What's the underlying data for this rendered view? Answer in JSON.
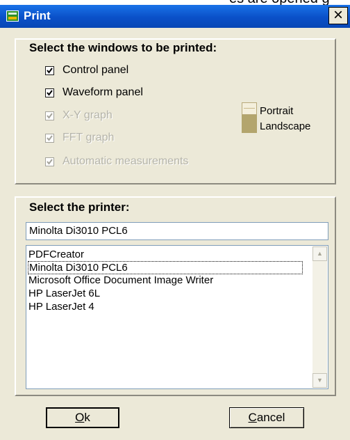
{
  "top_strip_text": "es are opened g",
  "window": {
    "title": "Print",
    "close_glyph": "×",
    "icon": "oscilloscope-app-icon"
  },
  "windows_section": {
    "heading": "Select the windows to be printed:",
    "items": [
      {
        "label": "Control panel",
        "checked": true,
        "enabled": true
      },
      {
        "label": "Waveform panel",
        "checked": true,
        "enabled": true
      },
      {
        "label": "X-Y graph",
        "checked": true,
        "enabled": false
      },
      {
        "label": "FFT graph",
        "checked": false,
        "enabled": false
      },
      {
        "label": "Automatic measurements",
        "checked": true,
        "enabled": false
      }
    ],
    "orientation": {
      "icon": "page-orientation-icon",
      "portrait_label": "Portrait",
      "landscape_label": "Landscape"
    }
  },
  "printer_section": {
    "heading": "Select the printer:",
    "selected_printer": "Minolta Di3010 PCL6",
    "printers": [
      "PDFCreator",
      "Minolta Di3010 PCL6",
      "Microsoft Office Document Image Writer",
      "HP LaserJet 6L",
      "HP LaserJet 4"
    ],
    "focused_index": 1
  },
  "buttons": {
    "ok_mnemonic": "O",
    "ok_rest": "k",
    "cancel_mnemonic": "C",
    "cancel_rest": "ancel"
  },
  "colors": {
    "titlebar": "#0a50c8",
    "dialog_bg": "#ece9d8",
    "disabled_text": "#b5b4a9"
  }
}
